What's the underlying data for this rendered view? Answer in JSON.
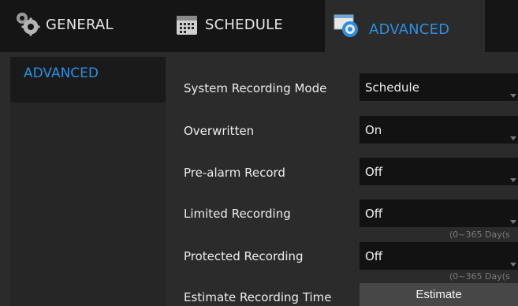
{
  "tabs": {
    "general": "GENERAL",
    "schedule": "SCHEDULE",
    "advanced": "ADVANCED"
  },
  "sidebar": {
    "items": [
      "ADVANCED"
    ]
  },
  "settings": {
    "system_recording_mode": {
      "label": "System Recording Mode",
      "value": "Schedule"
    },
    "overwritten": {
      "label": "Overwritten",
      "value": "On"
    },
    "pre_alarm_record": {
      "label": "Pre-alarm Record",
      "value": "Off"
    },
    "limited_recording": {
      "label": "Limited Recording",
      "value": "Off",
      "hint": "(0~365 Day(s"
    },
    "protected_recording": {
      "label": "Protected Recording",
      "value": "Off",
      "hint": "(0~365 Day(s"
    },
    "estimate_recording_time": {
      "label": "Estimate Recording Time",
      "button": "Estimate"
    }
  },
  "colors": {
    "accent": "#2e8fe0",
    "panel": "#2b2b2b",
    "field": "#121212",
    "button": "#474747"
  },
  "icons": {
    "general": "gear-icon",
    "schedule": "calendar-icon",
    "advanced": "advanced-settings-icon"
  }
}
